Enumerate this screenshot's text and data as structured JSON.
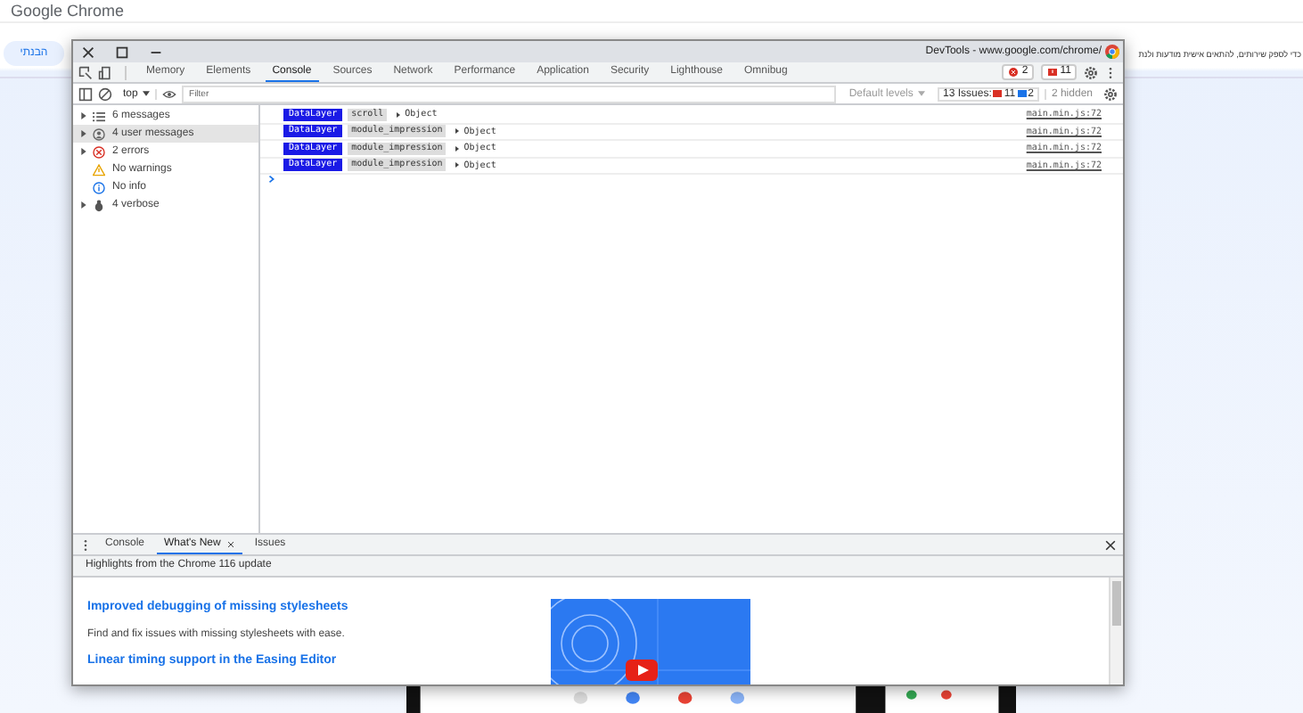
{
  "site": {
    "logo": "Google Chrome",
    "cookie_text": "כדי לספק שירותים, להתאים אישית מודעות ולנת",
    "cookie_button": "הבנתי"
  },
  "window": {
    "title": "DevTools - www.google.com/chrome/"
  },
  "tabs": [
    {
      "label": "Memory",
      "selected": false
    },
    {
      "label": "Elements",
      "selected": false
    },
    {
      "label": "Console",
      "selected": true
    },
    {
      "label": "Sources",
      "selected": false
    },
    {
      "label": "Network",
      "selected": false
    },
    {
      "label": "Performance",
      "selected": false
    },
    {
      "label": "Application",
      "selected": false
    },
    {
      "label": "Security",
      "selected": false
    },
    {
      "label": "Lighthouse",
      "selected": false
    },
    {
      "label": "Omnibug",
      "selected": false
    }
  ],
  "counters": {
    "errors": "2",
    "warnings": "11"
  },
  "toolbar": {
    "context": "top",
    "filter_placeholder": "Filter",
    "levels": "Default levels",
    "issues_label": "13 Issues:",
    "issues_warnings": "11",
    "issues_info": "2",
    "hidden": "2 hidden"
  },
  "sidebar": {
    "items": [
      {
        "kind": "list",
        "label": "6 messages",
        "expandable": true,
        "selected": false
      },
      {
        "kind": "user",
        "label": "4 user messages",
        "expandable": true,
        "selected": true
      },
      {
        "kind": "error",
        "label": "2 errors",
        "expandable": true,
        "selected": false
      },
      {
        "kind": "warning",
        "label": "No warnings",
        "expandable": false,
        "selected": false
      },
      {
        "kind": "info",
        "label": "No info",
        "expandable": false,
        "selected": false
      },
      {
        "kind": "verbose",
        "label": "4 verbose",
        "expandable": true,
        "selected": false
      }
    ]
  },
  "messages": [
    {
      "tag": "DataLayer",
      "event": "scroll",
      "value": "Object",
      "source": "main.min.js:72"
    },
    {
      "tag": "DataLayer",
      "event": "module_impression",
      "value": "Object",
      "source": "main.min.js:72"
    },
    {
      "tag": "DataLayer",
      "event": "module_impression",
      "value": "Object",
      "source": "main.min.js:72"
    },
    {
      "tag": "DataLayer",
      "event": "module_impression",
      "value": "Object",
      "source": "main.min.js:72"
    }
  ],
  "drawer": {
    "tabs": [
      {
        "label": "Console",
        "selected": false,
        "closable": false
      },
      {
        "label": "What's New",
        "selected": true,
        "closable": true
      },
      {
        "label": "Issues",
        "selected": false,
        "closable": false
      }
    ],
    "banner": "Highlights from the Chrome 116 update",
    "articles": [
      {
        "title": "Improved debugging of missing stylesheets",
        "text": "Find and fix issues with missing stylesheets with ease."
      },
      {
        "title": "Linear timing support in the Easing Editor"
      }
    ]
  }
}
